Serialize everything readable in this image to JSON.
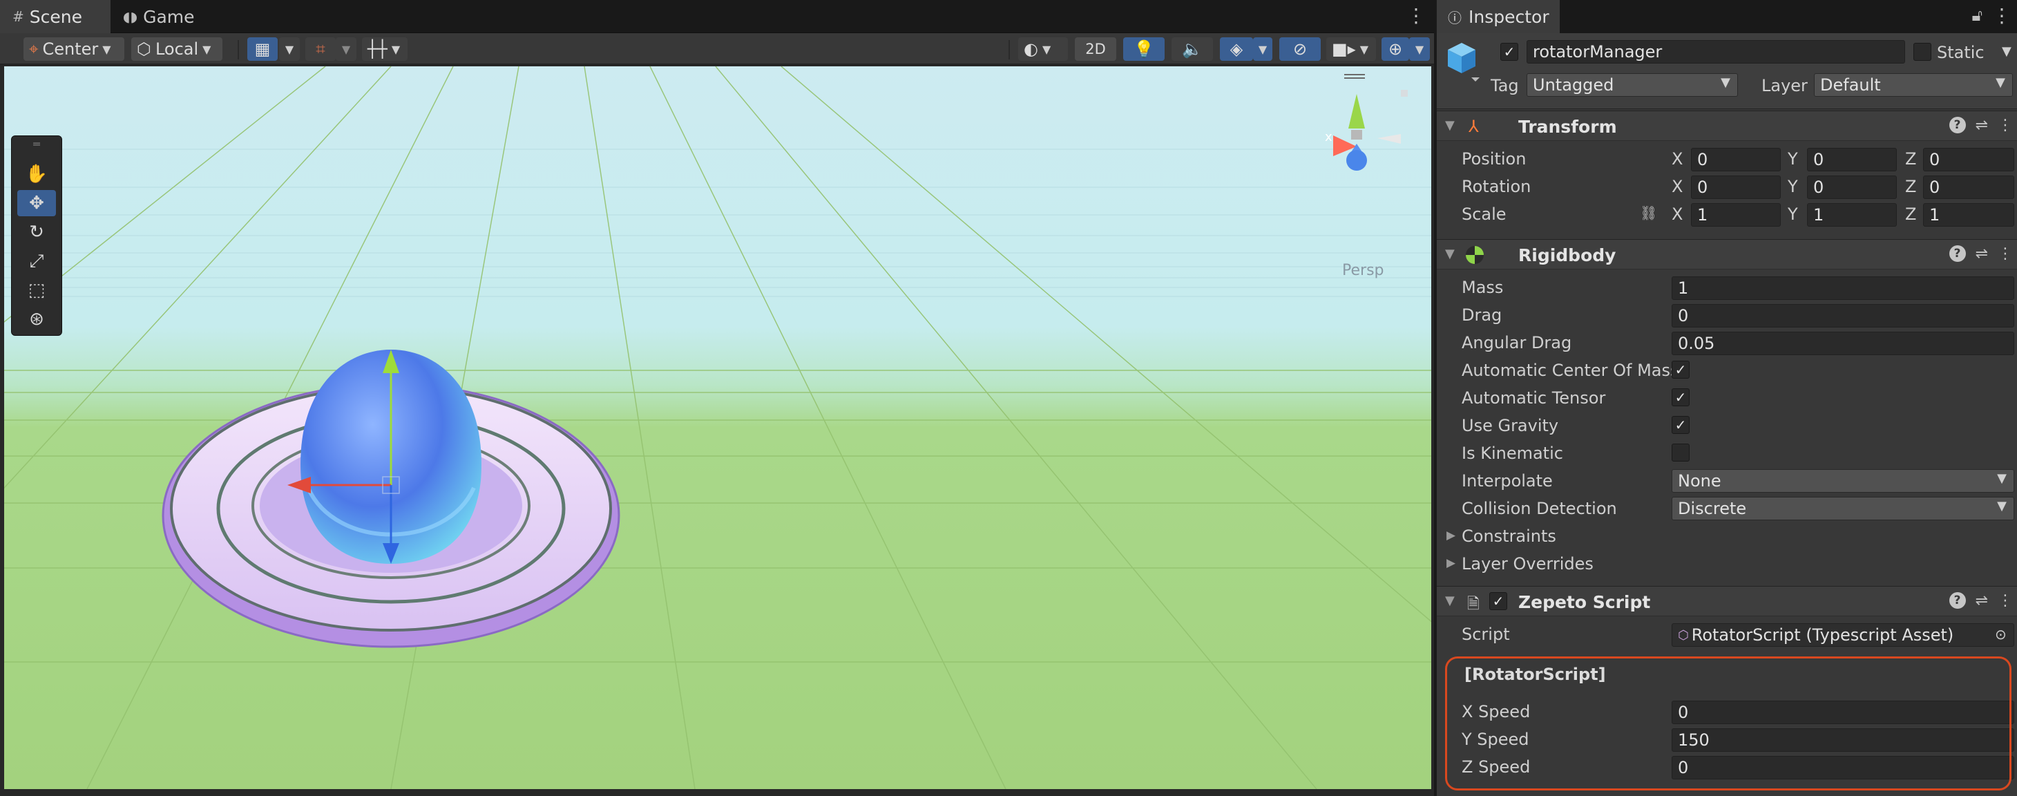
{
  "scene_tabs": [
    {
      "label": "Scene",
      "icon": "hash-grid-icon"
    },
    {
      "label": "Game",
      "icon": "gamepad-icon"
    }
  ],
  "toolbar": {
    "pivot_label": "Center",
    "space_label": "Local",
    "mode_2d": "2D"
  },
  "viewport": {
    "gizmo_label": "Persp"
  },
  "inspector": {
    "tab_label": "Inspector",
    "object_name": "rotatorManager",
    "active": true,
    "static_label": "Static",
    "tag_label": "Tag",
    "tag_value": "Untagged",
    "layer_label": "Layer",
    "layer_value": "Default"
  },
  "transform": {
    "title": "Transform",
    "rows": [
      {
        "label": "Position",
        "x": "0",
        "y": "0",
        "z": "0"
      },
      {
        "label": "Rotation",
        "x": "0",
        "y": "0",
        "z": "0"
      },
      {
        "label": "Scale",
        "x": "1",
        "y": "1",
        "z": "1"
      }
    ]
  },
  "rigidbody": {
    "title": "Rigidbody",
    "mass_label": "Mass",
    "mass": "1",
    "drag_label": "Drag",
    "drag": "0",
    "angular_label": "Angular Drag",
    "angular": "0.05",
    "auto_com_label": "Automatic Center Of Mass",
    "auto_com": true,
    "auto_tensor_label": "Automatic Tensor",
    "auto_tensor": true,
    "gravity_label": "Use Gravity",
    "gravity": true,
    "kinematic_label": "Is Kinematic",
    "kinematic": false,
    "interpolate_label": "Interpolate",
    "interpolate": "None",
    "collision_label": "Collision Detection",
    "collision": "Discrete",
    "constraints_label": "Constraints",
    "overrides_label": "Layer Overrides"
  },
  "zepeto": {
    "title": "Zepeto Script",
    "script_label": "Script",
    "script_value": "RotatorScript (Typescript Asset)",
    "section": "[RotatorScript]",
    "x_label": "X Speed",
    "x_speed": "0",
    "y_label": "Y Speed",
    "y_speed": "150",
    "z_label": "Z Speed",
    "z_speed": "0"
  },
  "colors": {
    "highlight": "#d9481f",
    "accent": "#3a5f93"
  }
}
